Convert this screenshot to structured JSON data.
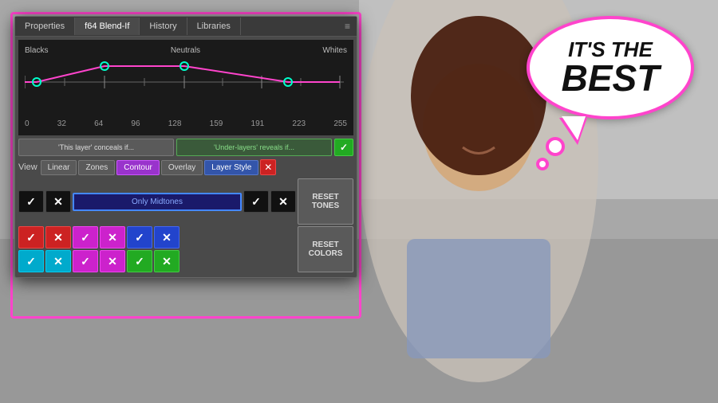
{
  "panel": {
    "tabs": [
      {
        "label": "Properties",
        "active": false
      },
      {
        "label": "f64 Blend-If",
        "active": true
      },
      {
        "label": "History",
        "active": false
      },
      {
        "label": "Libraries",
        "active": false
      }
    ],
    "chart": {
      "labels_top": [
        "Blacks",
        "Neutrals",
        "Whites"
      ],
      "labels_bottom": [
        "0",
        "32",
        "64",
        "96",
        "128",
        "159",
        "191",
        "223",
        "255"
      ]
    },
    "layer_buttons": {
      "this_layer": "'This layer' conceals if...",
      "under_layer": "'Under-layers' reveals if...",
      "green_icon": "✓"
    },
    "view": {
      "label": "View",
      "buttons": [
        "Linear",
        "Zones",
        "Contour",
        "Overlay",
        "Layer Style"
      ]
    },
    "reset_tones": "RESET TONES",
    "reset_colors": "RESET\nCOLORS",
    "midtones": "Only Midtones"
  },
  "speech_bubble": {
    "line1": "IT'S THE",
    "line2": "BEST"
  }
}
